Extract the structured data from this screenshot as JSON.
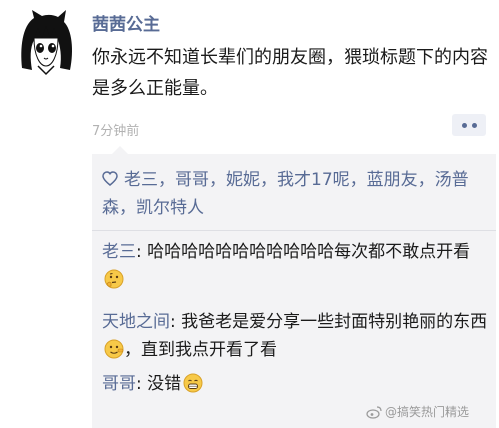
{
  "post": {
    "author": "茜茜公主",
    "text": "你永远不知道长辈们的朋友圈，猥琐标题下的内容是多么正能量。",
    "timestamp": "7分钟前"
  },
  "likes": {
    "names": "老三，哥哥，妮妮，我才17呢，蓝朋友，汤普森，凯尔特人"
  },
  "comments": [
    {
      "name": "老三",
      "sep": ": ",
      "text": "哈哈哈哈哈哈哈哈哈哈哈每次都不敢点开看",
      "emoji": "thinking-face-icon"
    },
    {
      "name": "天地之间",
      "sep": ": ",
      "text": "我爸老是爱分享一些封面特别艳丽的东西",
      "emoji": "lying-face-icon",
      "text_after": "，直到我点开看了看"
    },
    {
      "name": "哥哥",
      "sep": ": ",
      "text": "没错",
      "emoji": "grinning-face-icon"
    }
  ],
  "watermark": "@搞笑热门精选",
  "colors": {
    "link_blue": "#586b95",
    "panel_bg": "#f3f3f5"
  }
}
